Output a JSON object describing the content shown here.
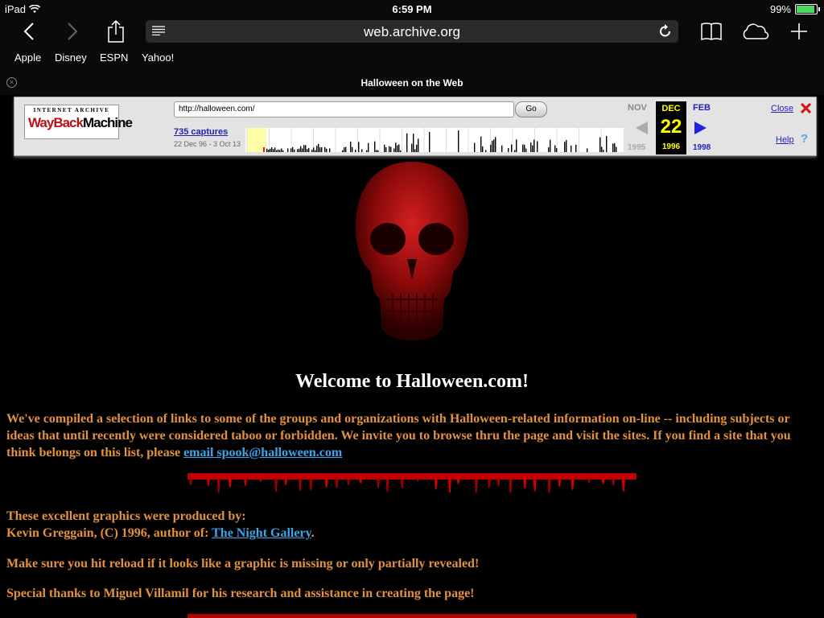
{
  "status_bar": {
    "device": "iPad",
    "time": "6:59 PM",
    "battery": "99%"
  },
  "browser": {
    "url": "web.archive.org",
    "bookmarks": [
      "Apple",
      "Disney",
      "ESPN",
      "Yahoo!"
    ],
    "tab_title": "Halloween on the Web"
  },
  "wayback": {
    "logo_top": "INTERNET ARCHIVE",
    "logo_main_1": "WayBack",
    "logo_main_2": "Machine",
    "url_value": "http://halloween.com/",
    "go_label": "Go",
    "captures": "735 captures",
    "range": "22 Dec 96 - 3 Oct 13",
    "prev_month": "NOV",
    "cur_month": "DEC",
    "next_month": "FEB",
    "cur_day": "22",
    "prev_year": "1995",
    "cur_year": "1996",
    "next_year": "1998",
    "close_label": "Close",
    "help_label": "Help"
  },
  "page": {
    "welcome": "Welcome to Halloween.com!",
    "intro": "We've compiled a selection of links to some of the groups and organizations with Halloween-related information on-line -- including subjects or ideas that until recently were considered taboo or forbidden. We invite you to browse thru the page and visit the sites. If you find a site that you think belongs on this list, please",
    "email_link": "email spook@halloween.com",
    "credits_line1": "These excellent graphics were produced by:",
    "credits_line2": "Kevin Greggain, (C) 1996, author of:",
    "night_gallery_link": "The Night Gallery",
    "reload_note": "Make sure you hit reload if it looks like a graphic is missing or only partially revealed!",
    "thanks": "Special thanks to Miguel Villamil for his research and assistance in creating the page!"
  },
  "colors": {
    "body_text": "#e3913f",
    "link": "#3aa6e8",
    "wayback_day": "#ffff00"
  }
}
